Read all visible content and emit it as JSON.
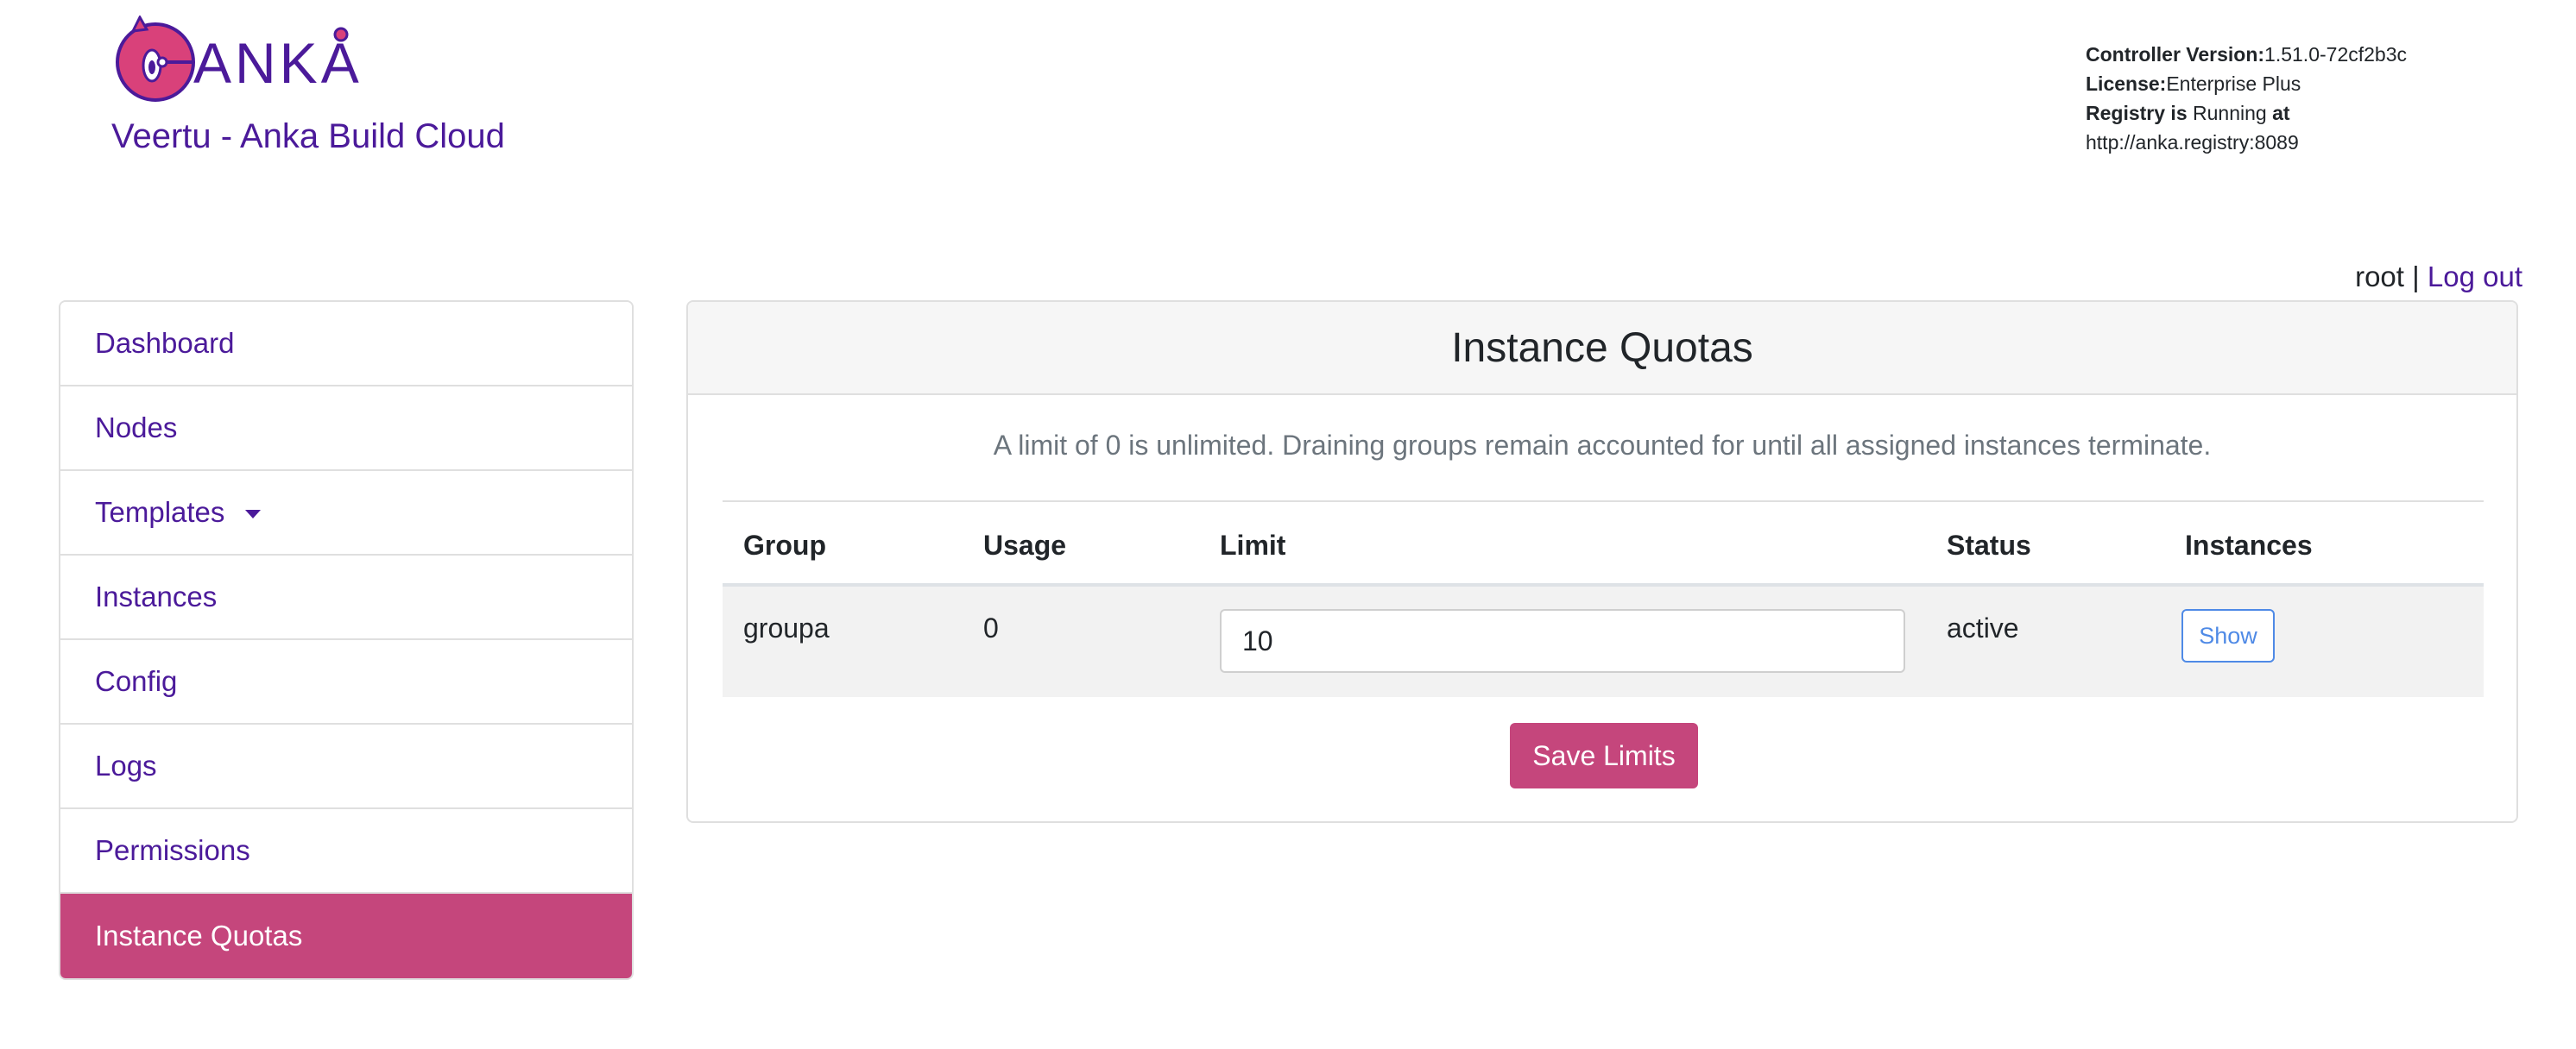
{
  "app": {
    "brand": "Veertu - Anka Build Cloud",
    "logo_text": "ANKA"
  },
  "info": {
    "controller_label": "Controller Version:",
    "controller_value": "1.51.0-72cf2b3c",
    "license_label": "License:",
    "license_value": "Enterprise Plus",
    "registry_label": "Registry is",
    "registry_status": "Running",
    "registry_at": "at",
    "registry_url": "http://anka.registry:8089"
  },
  "user": {
    "name": "root",
    "separator": "|",
    "logout_label": "Log out"
  },
  "sidebar": {
    "items": [
      {
        "label": "Dashboard"
      },
      {
        "label": "Nodes"
      },
      {
        "label": "Templates"
      },
      {
        "label": "Instances"
      },
      {
        "label": "Config"
      },
      {
        "label": "Logs"
      },
      {
        "label": "Permissions"
      },
      {
        "label": "Instance Quotas"
      }
    ]
  },
  "main": {
    "title": "Instance Quotas",
    "note": "A limit of 0 is unlimited. Draining groups remain accounted for until all assigned instances terminate.",
    "table": {
      "headers": [
        "Group",
        "Usage",
        "Limit",
        "Status",
        "Instances"
      ],
      "rows": [
        {
          "group": "groupa",
          "usage": "0",
          "limit": "10",
          "status": "active",
          "instances_button": "Show"
        }
      ]
    },
    "save_label": "Save Limits"
  },
  "colors": {
    "brand_purple": "#4b1a9a",
    "accent_pink": "#c5467c",
    "link_blue": "#4f8ae6"
  }
}
